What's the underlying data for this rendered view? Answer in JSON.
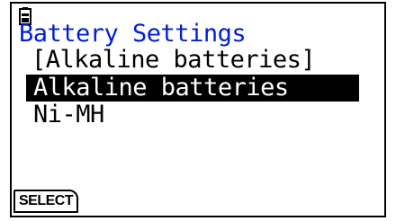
{
  "status_bar": {
    "icon": "battery-icon"
  },
  "screen": {
    "title": "Battery Settings",
    "current_setting": "[Alkaline batteries]"
  },
  "options": [
    {
      "label": "Alkaline batteries",
      "selected": true
    },
    {
      "label": "Ni-MH",
      "selected": false
    }
  ],
  "softkeys": {
    "f1": "SELECT"
  },
  "colors": {
    "title": "#001fd6",
    "highlight": "#000000",
    "background": "#ffffff"
  }
}
